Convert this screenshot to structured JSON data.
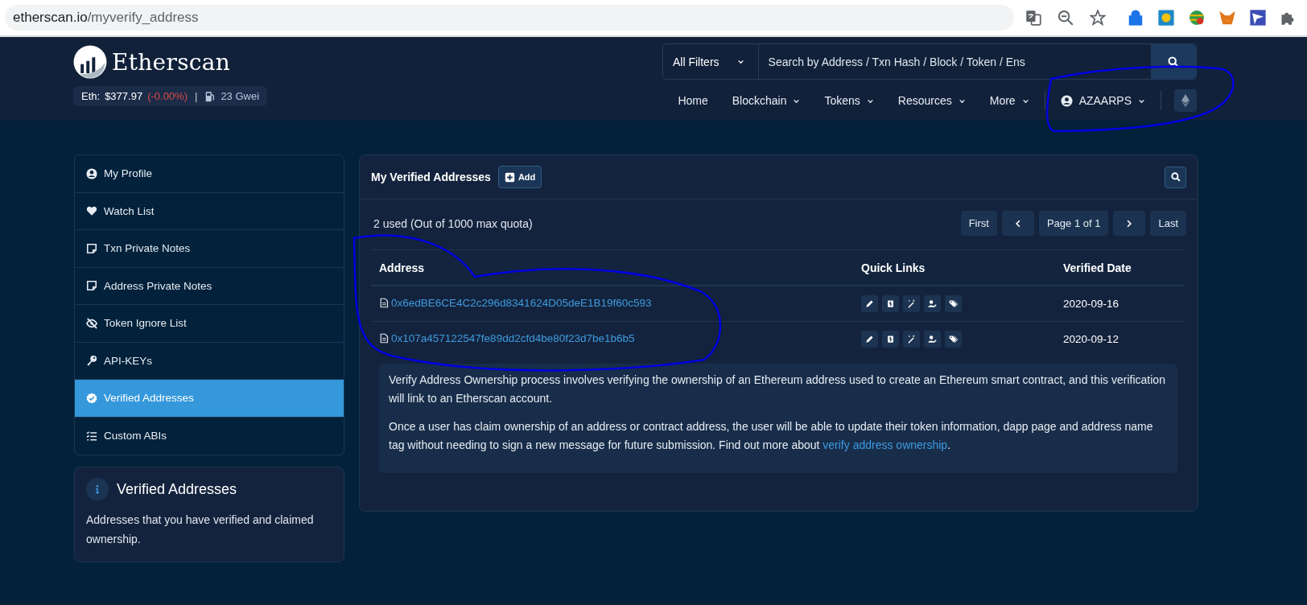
{
  "browser": {
    "url_host": "etherscan.io",
    "url_path": "/myverify_address"
  },
  "header": {
    "logo": "Etherscan",
    "price_label": "Eth:",
    "price": "$377.97",
    "change": "(-0.00%)",
    "separator": "|",
    "gas": "23 Gwei",
    "filter": "All Filters",
    "search_placeholder": "Search by Address / Txn Hash / Block / Token / Ens",
    "nav": [
      {
        "label": "Home",
        "dropdown": false
      },
      {
        "label": "Blockchain",
        "dropdown": true
      },
      {
        "label": "Tokens",
        "dropdown": true
      },
      {
        "label": "Resources",
        "dropdown": true
      },
      {
        "label": "More",
        "dropdown": true
      }
    ],
    "account": "AZAARPS"
  },
  "sidebar": {
    "items": [
      {
        "label": "My Profile",
        "kind": "user",
        "selected": false
      },
      {
        "label": "Watch List",
        "kind": "heart",
        "selected": false
      },
      {
        "label": "Txn Private Notes",
        "kind": "note",
        "selected": false
      },
      {
        "label": "Address Private Notes",
        "kind": "note",
        "selected": false
      },
      {
        "label": "Token Ignore List",
        "kind": "hidden",
        "selected": false
      },
      {
        "label": "API-KEYs",
        "kind": "key",
        "selected": false
      },
      {
        "label": "Verified Addresses",
        "kind": "badge",
        "selected": true
      },
      {
        "label": "Custom ABIs",
        "kind": "list",
        "selected": false
      }
    ]
  },
  "info_card": {
    "title": "Verified Addresses",
    "text": "Addresses that you have verified and claimed ownership."
  },
  "main": {
    "title": "My Verified Addresses",
    "add_button": "Add",
    "quota": "2 used (Out of 1000 max quota)",
    "pagination": {
      "first": "First",
      "page": "Page 1 of 1",
      "last": "Last"
    },
    "table": {
      "columns": [
        "Address",
        "Quick Links",
        "Verified Date"
      ],
      "rows": [
        {
          "address": "0x6edBE6CE4C2c296d8341624D05deE1B19f60c593",
          "date": "2020-09-16"
        },
        {
          "address": "0x107a457122547fe89dd2cfd4be80f23d7be1b6b5",
          "date": "2020-09-12"
        }
      ]
    },
    "note": [
      {
        "text": "Verify Address Ownership process involves verifying the ownership of an Ethereum address used to create an Ethereum smart contract, and this verification will link to an Etherscan account."
      },
      {
        "text": "Once a user has claim ownership of an address or contract address, the user will be able to update their token information, dapp page and address name tag without needing to sign a new message for future submission. Find out more about ",
        "link": "verify address ownership",
        "after": "."
      }
    ]
  }
}
